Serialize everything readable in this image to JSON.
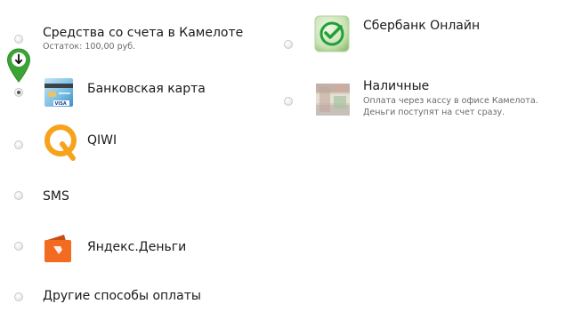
{
  "payment_options": {
    "balance": {
      "label": "Средства со счета в Камелоте",
      "sub": "Остаток: 100,00 руб.",
      "selected": false
    },
    "bank_card": {
      "label": "Банковская карта",
      "card_brand": "VISA",
      "selected": true
    },
    "qiwi": {
      "label": "QIWI",
      "selected": false
    },
    "sms": {
      "label": "SMS",
      "selected": false
    },
    "yandex_money": {
      "label": "Яндекс.Деньги",
      "selected": false
    },
    "other": {
      "label": "Другие способы оплаты",
      "selected": false
    },
    "sberbank": {
      "label": "Сбербанк Онлайн",
      "selected": false
    },
    "cash": {
      "label": "Наличные",
      "sub_line1": "Оплата через кассу в офисе Камелота.",
      "sub_line2": "Деньги поступят на счет сразу.",
      "selected": false
    }
  },
  "marker": {
    "icon": "down-arrow-pin-icon",
    "color": "#3aa435"
  },
  "colors": {
    "qiwi_orange": "#f7a21b",
    "yandex_orange": "#f26b21",
    "sberbank_green": "#21a038"
  }
}
